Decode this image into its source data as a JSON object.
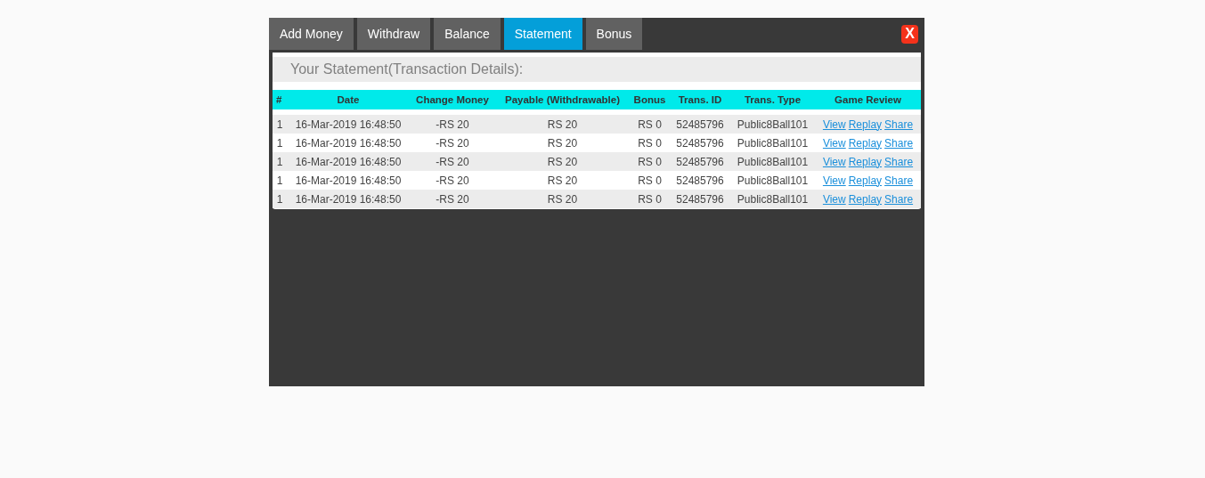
{
  "tabs": [
    {
      "label": "Add Money",
      "selected": false
    },
    {
      "label": "Withdraw",
      "selected": false
    },
    {
      "label": "Balance",
      "selected": false
    },
    {
      "label": "Statement",
      "selected": true
    },
    {
      "label": "Bonus",
      "selected": false
    }
  ],
  "close_button": "X",
  "panel_title": "Your Statement(Transaction Details):",
  "table": {
    "columns": [
      "#",
      "Date",
      "Change Money",
      "Payable (Withdrawable)",
      "Bonus",
      "Trans. ID",
      "Trans. Type",
      "Game Review"
    ],
    "rows": [
      {
        "cells": [
          "1",
          "16-Mar-2019 16:48:50",
          "-RS 20",
          "RS 20",
          "RS 0",
          "52485796",
          "Public8Ball101"
        ],
        "links": [
          "View",
          "Replay",
          "Share"
        ]
      },
      {
        "cells": [
          "1",
          "16-Mar-2019 16:48:50",
          "-RS 20",
          "RS 20",
          "RS 0",
          "52485796",
          "Public8Ball101"
        ],
        "links": [
          "View",
          "Replay",
          "Share"
        ]
      },
      {
        "cells": [
          "1",
          "16-Mar-2019 16:48:50",
          "-RS 20",
          "RS 20",
          "RS 0",
          "52485796",
          "Public8Ball101"
        ],
        "links": [
          "View",
          "Replay",
          "Share"
        ]
      },
      {
        "cells": [
          "1",
          "16-Mar-2019 16:48:50",
          "-RS 20",
          "RS 20",
          "RS 0",
          "52485796",
          "Public8Ball101"
        ],
        "links": [
          "View",
          "Replay",
          "Share"
        ]
      },
      {
        "cells": [
          "1",
          "16-Mar-2019 16:48:50",
          "-RS 20",
          "RS 20",
          "RS 0",
          "52485796",
          "Public8Ball101"
        ],
        "links": [
          "View",
          "Replay",
          "Share"
        ]
      }
    ]
  }
}
